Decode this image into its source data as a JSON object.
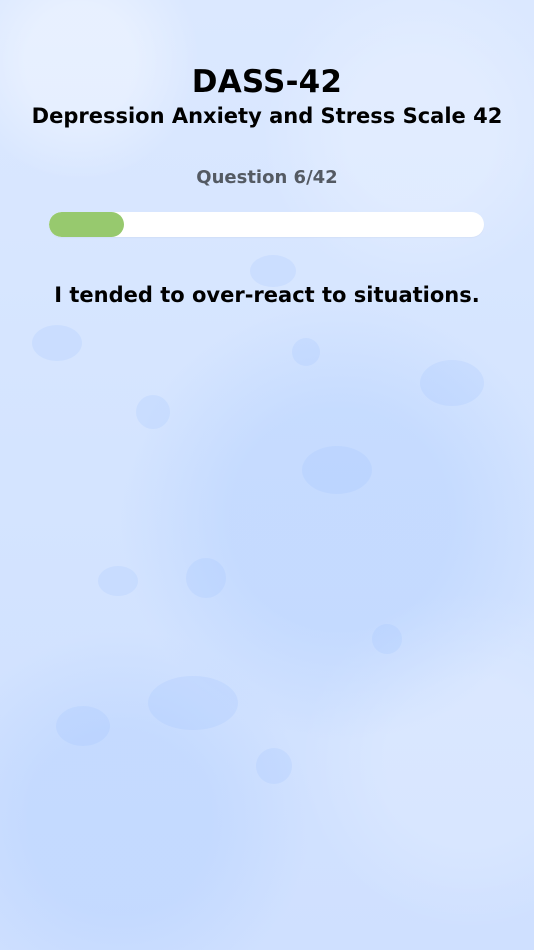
{
  "app": {
    "title": "DASS-42",
    "subtitle": "Depression Anxiety and Stress Scale 42"
  },
  "progress": {
    "label": "Question 6/42",
    "current": 6,
    "total": 42,
    "fraction": 0.1724,
    "fill_color": "#97c96e",
    "track_color": "#ffffff"
  },
  "question": {
    "text": "I tended to over-react to situations."
  },
  "theme": {
    "background": "#d6e6ff",
    "text_primary": "#000000",
    "text_secondary": "#545a63"
  }
}
